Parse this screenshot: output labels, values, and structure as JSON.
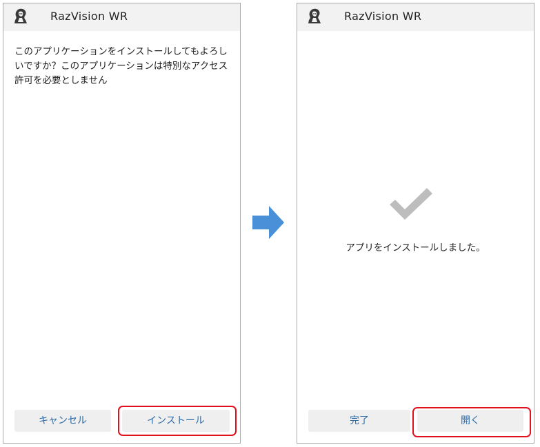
{
  "left_panel": {
    "app_title": "RazVision WR",
    "icon": "app-logo-icon",
    "message": "このアプリケーションをインストールしてもよろしいですか？このアプリケーションは特別なアクセス許可を必要としません",
    "cancel_label": "キャンセル",
    "install_label": "インストール"
  },
  "right_panel": {
    "app_title": "RazVision WR",
    "icon": "app-logo-icon",
    "done_message": "アプリをインストールしました。",
    "finish_label": "完了",
    "open_label": "開く"
  },
  "transition_icon": "arrow-right-icon",
  "colors": {
    "accent_text": "#2e6ca8",
    "highlight": "#e0101c",
    "arrow": "#4a90d9",
    "checkmark": "#bdbdbd"
  }
}
